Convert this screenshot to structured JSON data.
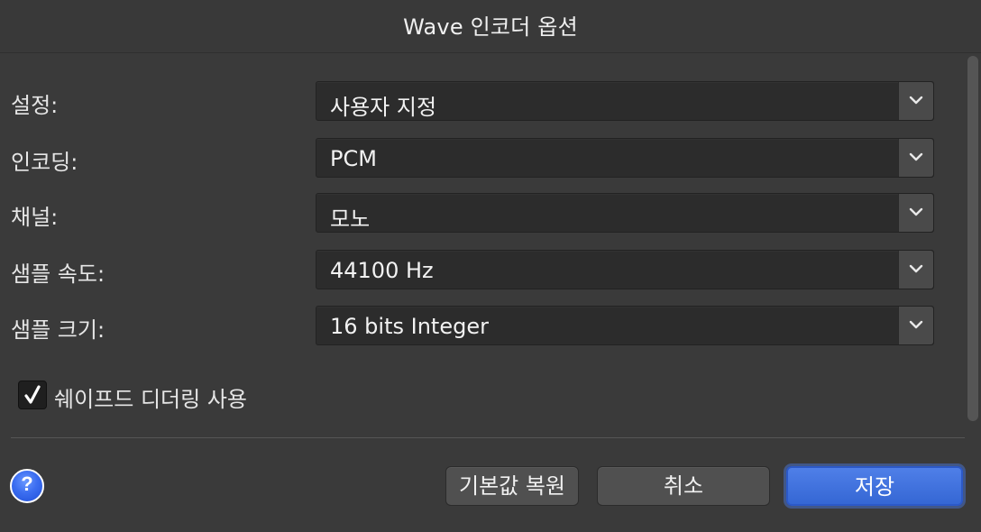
{
  "dialog": {
    "title": "Wave 인코더 옵션"
  },
  "fields": [
    {
      "label": "설정:",
      "value": "사용자 지정"
    },
    {
      "label": "인코딩:",
      "value": "PCM"
    },
    {
      "label": "채널:",
      "value": "모노"
    },
    {
      "label": "샘플 속도:",
      "value": "44100 Hz"
    },
    {
      "label": "샘플 크기:",
      "value": "16 bits Integer"
    }
  ],
  "options": {
    "shaped_dithering": {
      "label": "쉐이프드 디더링 사용",
      "checked": true
    }
  },
  "buttons": {
    "help_symbol": "?",
    "restore_defaults": "기본값 복원",
    "cancel": "취소",
    "save": "저장"
  },
  "colors": {
    "primary_button": "#3567d4",
    "help_button": "#3b6df0",
    "background": "#3a3a3a"
  }
}
